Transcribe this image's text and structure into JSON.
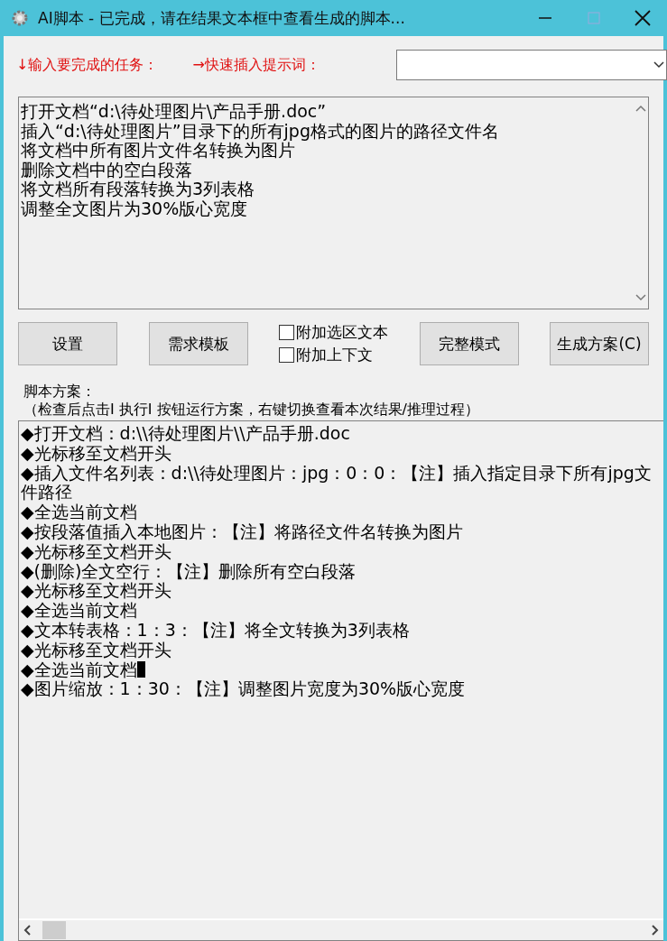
{
  "window": {
    "title": "AI脚本 - 已完成，请在结果文本框中查看生成的脚本..."
  },
  "task_label": "↓输入要完成的任务：",
  "prompt_label": "→快速插入提示词：",
  "task_lines": [
    "打开文档“d:\\待处理图片\\产品手册.doc”",
    "插入“d:\\待处理图片”目录下的所有jpg格式的图片的路径文件名",
    "将文档中所有图片文件名转换为图片",
    "删除文档中的空白段落",
    "将文档所有段落转换为3列表格",
    "调整全文图片为30%版心宽度"
  ],
  "buttons": [
    {
      "label": "设置",
      "kind": "button"
    },
    {
      "label": "需求模板",
      "kind": "button"
    },
    {
      "kind": "checks",
      "items": [
        {
          "label": "附加选区文本",
          "checked": false
        },
        {
          "label": "附加上下文",
          "checked": false
        }
      ]
    },
    {
      "label": "完整模式",
      "kind": "button"
    },
    {
      "label": "生成方案(C)",
      "kind": "button"
    }
  ],
  "script_label": "脚本方案：",
  "script_hint": "（检查后点击Ⅰ 执行Ⅰ 按钮运行方案，右键切换查看本次结果/推理过程）",
  "script_lines": [
    {
      "text": "◆打开文档：d:\\\\待处理图片\\\\产品手册.doc",
      "caret": false
    },
    {
      "text": "◆光标移至文档开头",
      "caret": false
    },
    {
      "text": "◆插入文件名列表：d:\\\\待处理图片：jpg：0：0：【注】插入指定目录下所有jpg文件路径",
      "caret": false
    },
    {
      "text": "◆全选当前文档",
      "caret": false
    },
    {
      "text": "◆按段落值插入本地图片：【注】将路径文件名转换为图片",
      "caret": false
    },
    {
      "text": "◆光标移至文档开头",
      "caret": false
    },
    {
      "text": "◆(删除)全文空行：【注】删除所有空白段落",
      "caret": false
    },
    {
      "text": "◆光标移至文档开头",
      "caret": false
    },
    {
      "text": "◆全选当前文档",
      "caret": false
    },
    {
      "text": "◆文本转表格：1：3：【注】将全文转换为3列表格",
      "caret": false
    },
    {
      "text": "◆光标移至文档开头",
      "caret": false
    },
    {
      "text": "◆全选当前文档",
      "caret": true
    },
    {
      "text": "◆图片缩放：1：30：【注】调整图片宽度为30%版心宽度",
      "caret": false
    }
  ]
}
